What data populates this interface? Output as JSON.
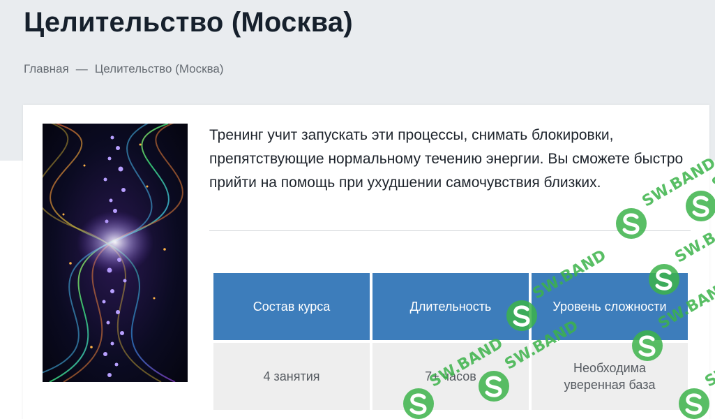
{
  "header": {
    "title": "Целительство (Москва)"
  },
  "breadcrumb": {
    "home": "Главная",
    "separator": "—",
    "current": "Целительство (Москва)"
  },
  "content": {
    "description": "Тренинг учит запускать эти процессы, снимать блокировки, препятствующие нормальному течению энергии. Вы сможете быстро прийти на помощь при ухудшении самочувствия близких."
  },
  "table": {
    "headers": [
      "Состав курса",
      "Длительность",
      "Уровень сложности"
    ],
    "row": [
      "4 занятия",
      "7+ часов",
      "Необходима уверенная база"
    ]
  },
  "watermark": {
    "text": "SW.BAND",
    "color": "#3cb34a"
  },
  "colors": {
    "table_header": "#3d7dbb",
    "table_cell": "#eeeeee",
    "hero_bg": "#e9ecef"
  }
}
